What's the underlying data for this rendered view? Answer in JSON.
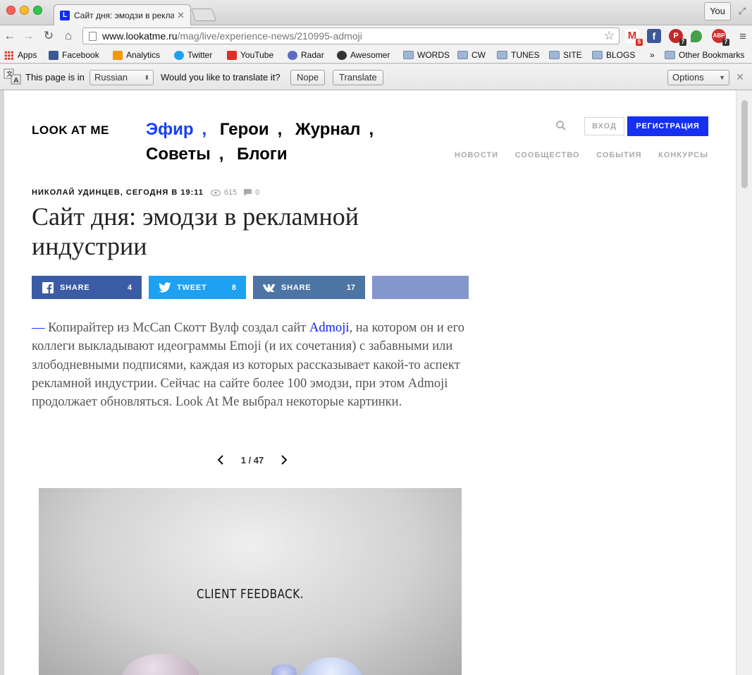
{
  "window": {
    "tab_title": "Сайт дня: эмодзи в рекла",
    "tab_favicon_letter": "L",
    "profile": "You"
  },
  "toolbar": {
    "url_host": "www.lookatme.ru",
    "url_path": "/mag/live/experience-news/210995-admoji",
    "extensions": [
      {
        "name": "gmail",
        "label": "M",
        "badge": "5",
        "color": "#d93025"
      },
      {
        "name": "facebook",
        "label": "f",
        "badge": "",
        "color": "#3b5998"
      },
      {
        "name": "pocket",
        "label": "P",
        "badge": "7",
        "color": "#c62828"
      },
      {
        "name": "evernote",
        "label": "",
        "badge": "",
        "color": "#43a047"
      },
      {
        "name": "adblock",
        "label": "ABP",
        "badge": "7",
        "color": "#d32f2f"
      }
    ]
  },
  "bookmarks": {
    "apps": "Apps",
    "items": [
      "Facebook",
      "Analytics",
      "Twitter",
      "YouTube",
      "Radar",
      "Awesomer"
    ],
    "folders": [
      "WORDS",
      "CW",
      "TUNES",
      "SITE",
      "BLOGS"
    ],
    "overflow": "»",
    "other": "Other Bookmarks"
  },
  "translate": {
    "prefix": "This page is in",
    "language": "Russian",
    "question": "Would you like to translate it?",
    "nope": "Nope",
    "translate": "Translate",
    "options": "Options"
  },
  "site": {
    "logo": "LOOK AT ME",
    "nav": [
      "Эфир",
      "Герои",
      "Журнал",
      "Советы",
      "Блоги"
    ],
    "login": "ВХОД",
    "register": "РЕГИСТРАЦИЯ",
    "subnav": [
      "НОВОСТИ",
      "СООБЩЕСТВО",
      "СОБЫТИЯ",
      "КОНКУРСЫ"
    ],
    "accent": "#1540f5"
  },
  "article": {
    "author_time": "НИКОЛАЙ УДИНЦЕВ, СЕГОДНЯ В 19:11",
    "views": "615",
    "comments": "0",
    "title": "Сайт дня: эмодзи в рекламной индустрии",
    "share": {
      "fb_label": "SHARE",
      "fb_count": "4",
      "tw_label": "TWEET",
      "tw_count": "8",
      "vk_label": "SHARE",
      "vk_count": "17"
    },
    "lead_dash": "—",
    "lead_before": " Копирайтер из McCan Скотт Вулф создал сайт ",
    "lead_link": "Admoji",
    "lead_after": ", на котором он и его коллеги выкладывают идеограммы Emoji (и их сочетания) с забавными или злободневными подписями, каждая из которых рассказывает какой-то аспект рекламной индустрии. Сейчас на сайте более 100 эмодзи, при этом Admoji продолжает обновляться. Look At Me выбрал некоторые картинки.",
    "pager": "1 / 47",
    "slide_caption": "CLIENT FEEDBACK."
  }
}
